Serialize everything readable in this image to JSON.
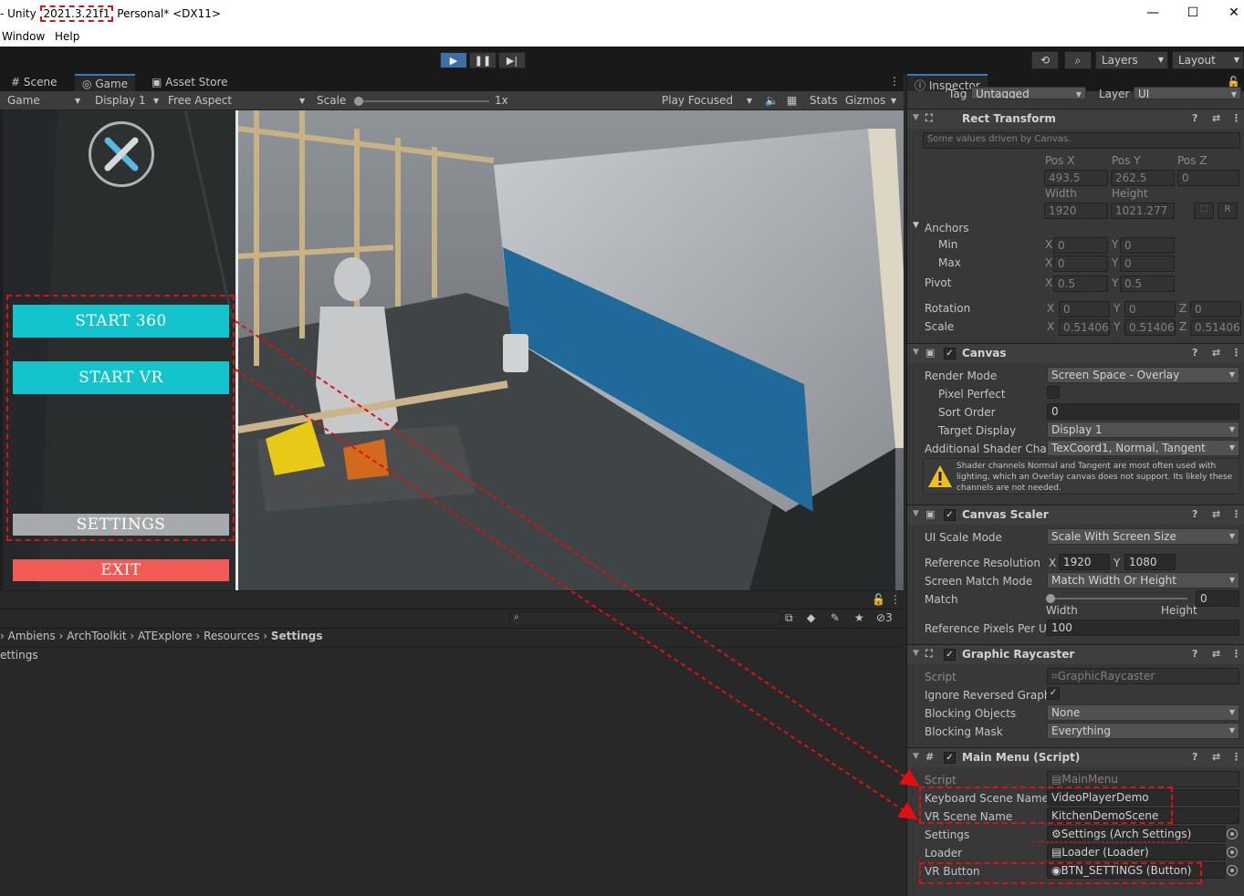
{
  "window": {
    "title_prefix": "- Unity",
    "version": "2021.3.21f1",
    "title_suffix": "Personal* <DX11>",
    "minimize": "—",
    "maximize": "☐",
    "close": "✕"
  },
  "menu": {
    "items": [
      "Window",
      "Help"
    ]
  },
  "toolbar": {
    "play": "▶",
    "pause": "❚❚",
    "step": "▶|",
    "layers": "Layers",
    "layout": "Layout"
  },
  "game_panel": {
    "tabs": [
      "Scene",
      "Game",
      "Asset Store"
    ],
    "game_dropdown": "Game",
    "display_dropdown": "Display 1",
    "aspect_dropdown": "Free Aspect",
    "scale_label": "Scale",
    "scale_value": "1x",
    "scale_fraction": 0.0,
    "play_focused": "Play Focused",
    "stats": "Stats",
    "gizmos": "Gizmos"
  },
  "game_menu": {
    "start360": "START 360",
    "startvr": "START VR",
    "settings": "SETTINGS",
    "exit": "EXIT",
    "colors": {
      "teal": "#14c4cc",
      "gray": "#a7aaac",
      "red": "#f25a55"
    }
  },
  "project_panel": {
    "breadcrumbs": [
      "Ambiens",
      "ArchToolkit",
      "ATExplore",
      "Resources",
      "Settings"
    ],
    "item": "ettings",
    "hidden_count": "3"
  },
  "inspector": {
    "title": "Inspector",
    "tag_label": "Tag",
    "tag_value": "Untagged",
    "layer_label": "Layer",
    "layer_value": "UI",
    "rect_transform": {
      "title": "Rect Transform",
      "note": "Some values driven by Canvas.",
      "posx_label": "Pos X",
      "posy_label": "Pos Y",
      "posz_label": "Pos Z",
      "posx": "493.5",
      "posy": "262.5",
      "posz": "0",
      "width_label": "Width",
      "height_label": "Height",
      "width": "1920",
      "height": "1021.277",
      "r_btn": "R",
      "anchors": "Anchors",
      "min": "Min",
      "max": "Max",
      "min_x": "0",
      "min_y": "0",
      "max_x": "0",
      "max_y": "0",
      "pivot": "Pivot",
      "pivot_x": "0.5",
      "pivot_y": "0.5",
      "rotation": "Rotation",
      "rot_x": "0",
      "rot_y": "0",
      "rot_z": "0",
      "scale": "Scale",
      "scale_x": "0.51406",
      "scale_y": "0.51406",
      "scale_z": "0.51406"
    },
    "canvas": {
      "title": "Canvas",
      "render_mode_label": "Render Mode",
      "render_mode": "Screen Space - Overlay",
      "pixel_perfect_label": "Pixel Perfect",
      "sort_order_label": "Sort Order",
      "sort_order": "0",
      "target_display_label": "Target Display",
      "target_display": "Display 1",
      "shader_label": "Additional Shader Chan",
      "shader": "TexCoord1, Normal, Tangent",
      "warning": "Shader channels Normal and Tangent are most often used with lighting, which an Overlay canvas does not support. Its likely these channels are not needed."
    },
    "canvas_scaler": {
      "title": "Canvas Scaler",
      "ui_scale_label": "UI Scale Mode",
      "ui_scale": "Scale With Screen Size",
      "ref_res_label": "Reference Resolution",
      "ref_x": "1920",
      "ref_y": "1080",
      "match_mode_label": "Screen Match Mode",
      "match_mode": "Match Width Or Height",
      "match_label": "Match",
      "match_value": "0",
      "match_fraction": 0.0,
      "width_label": "Width",
      "height_label": "Height",
      "rppu_label": "Reference Pixels Per Ur",
      "rppu": "100"
    },
    "graphic_raycaster": {
      "title": "Graphic Raycaster",
      "script_label": "Script",
      "script": "GraphicRaycaster",
      "ignore_label": "Ignore Reversed Graphi",
      "blocking_objects_label": "Blocking Objects",
      "blocking_objects": "None",
      "blocking_mask_label": "Blocking Mask",
      "blocking_mask": "Everything"
    },
    "main_menu": {
      "title": "Main Menu (Script)",
      "script_label": "Script",
      "script": "MainMenu",
      "keyboard_label": "Keyboard Scene Name",
      "keyboard": "VideoPlayerDemo",
      "vr_scene_label": "VR Scene Name",
      "vr_scene": "KitchenDemoScene",
      "settings_label": "Settings",
      "settings": "Settings (Arch Settings)",
      "loader_label": "Loader",
      "loader": "Loader (Loader)",
      "vr_button_label": "VR Button",
      "vr_button": "BTN_SETTINGS (Button)"
    }
  }
}
